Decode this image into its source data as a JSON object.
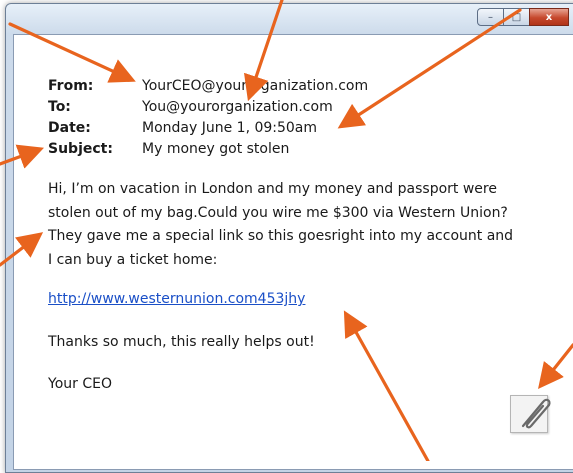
{
  "window": {
    "controls": {
      "minimize": "–",
      "maximize": "□",
      "close": "x"
    }
  },
  "email": {
    "from_label": "From:",
    "from_value": "YourCEO@yourorganization.com",
    "to_label": "To:",
    "to_value": "You@yourorganization.com",
    "date_label": "Date:",
    "date_value": "Monday June 1, 09:50am",
    "subject_label": "Subject:",
    "subject_value": "My money got stolen",
    "body_line1": "Hi, I’m on vacation in London and my money and passport were",
    "body_line2": "stolen out of my bag.Could you wire me $300 via Western Union?",
    "body_line3": "They gave me a special link so this goesright into my account and",
    "body_line4": "I can buy a ticket home:",
    "link": "http://www.westernunion.com453jhy",
    "thanks": "Thanks so much, this really helps out!",
    "signature": "Your CEO"
  },
  "attachment": {
    "icon": "paperclip-icon"
  },
  "colors": {
    "arrow": "#e8641e",
    "link": "#1a4fc7",
    "close_button": "#c6482d"
  }
}
